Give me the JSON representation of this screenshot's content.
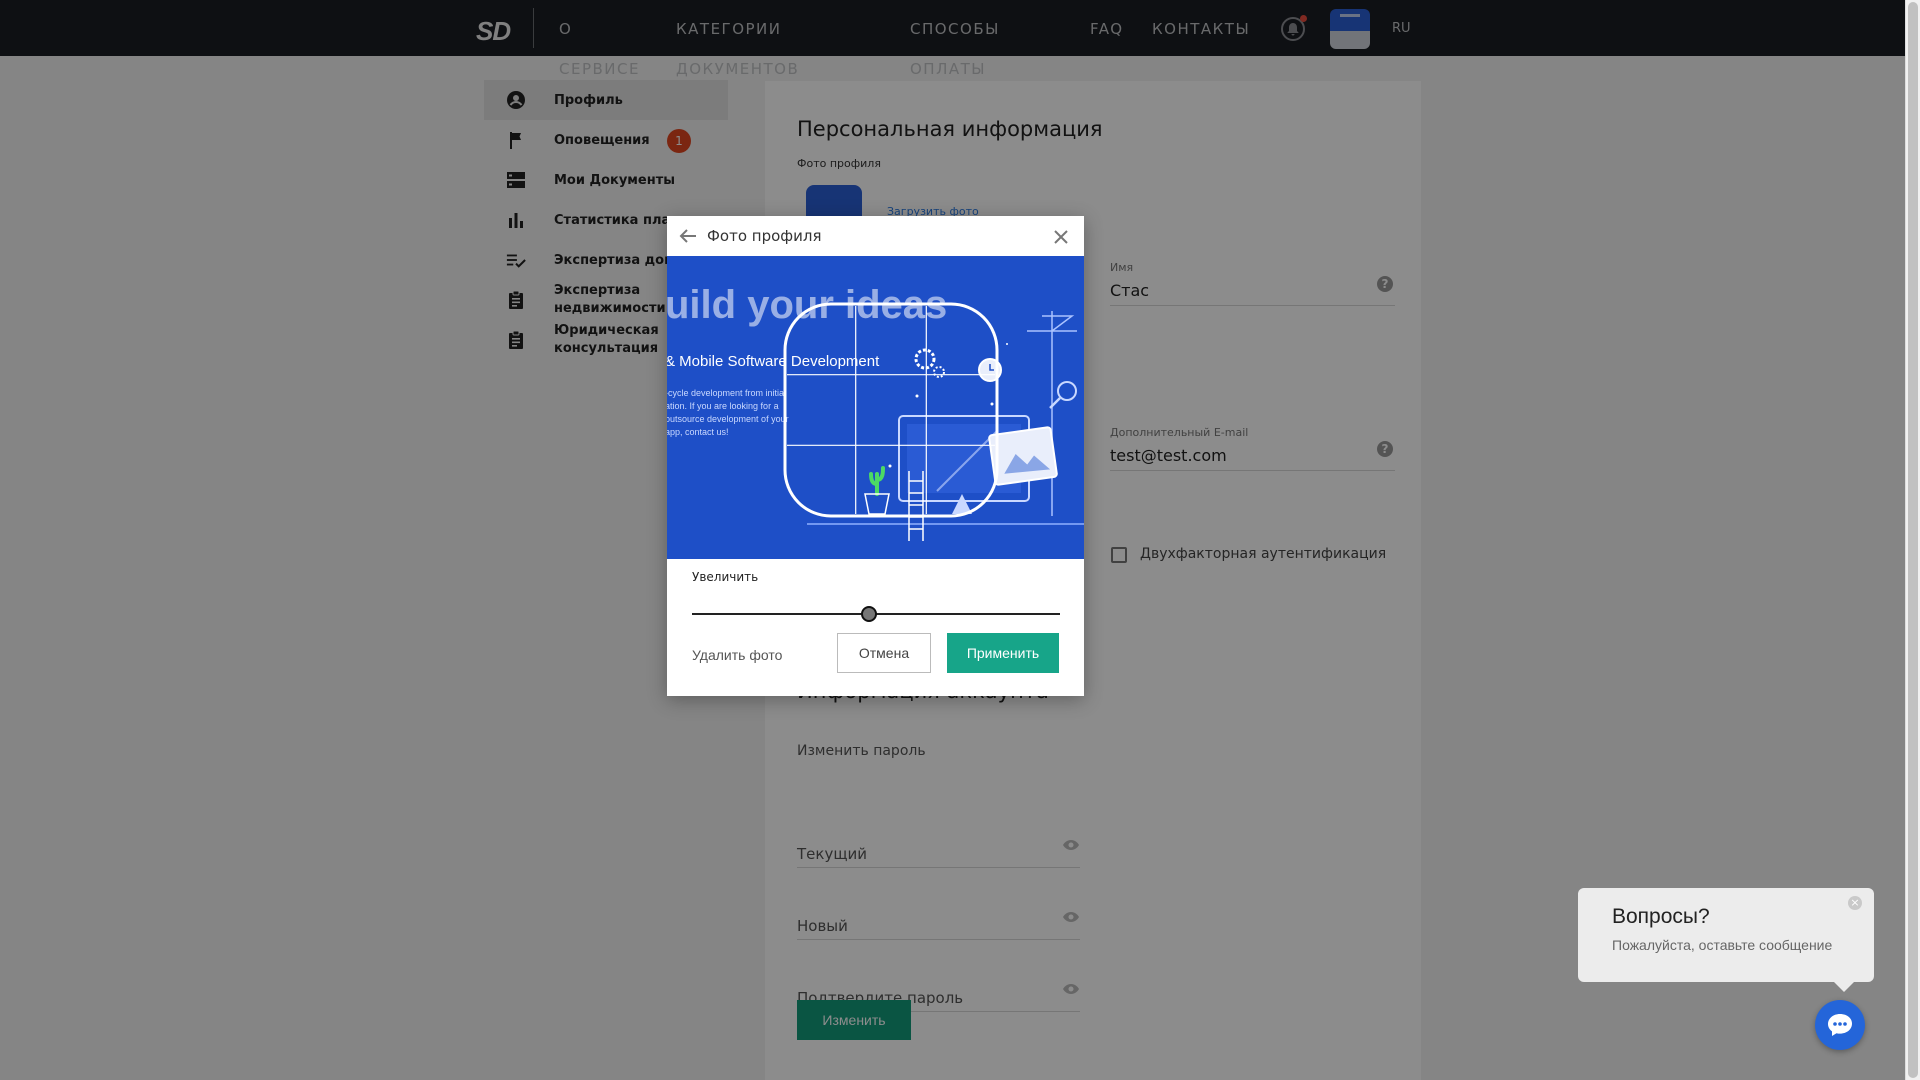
{
  "nav": {
    "logo": "SD",
    "items": [
      {
        "line1": "О",
        "line2": "СЕРВИСЕ"
      },
      {
        "line1": "КАТЕГОРИИ",
        "line2": "ДОКУМЕНТОВ"
      },
      {
        "line1": "СПОСОБЫ",
        "line2": "ОПЛАТЫ"
      },
      {
        "line1": "FAQ",
        "line2": ""
      },
      {
        "line1": "КОНТАКТЫ",
        "line2": ""
      }
    ],
    "language": "RU",
    "icons": [
      "bell-icon",
      "avatar"
    ]
  },
  "sidebar": {
    "items": [
      {
        "label": "Профиль",
        "icon": "person-circle-icon",
        "active": true
      },
      {
        "label": "Оповещения",
        "icon": "flag-icon",
        "badge": "1"
      },
      {
        "label": "Мои Документы",
        "icon": "storage-icon"
      },
      {
        "label": "Статистика плате",
        "icon": "bar-chart-icon"
      },
      {
        "label": "Экспертиза докум",
        "icon": "checklist-icon"
      },
      {
        "label": "Экспертиза недвижимости",
        "icon": "clipboard-icon"
      },
      {
        "label": "Юридическая консультация",
        "icon": "clipboard-icon"
      }
    ]
  },
  "profile": {
    "title": "Персональная информация",
    "photo_label": "Фото профиля",
    "upload_link": "Загрузить фото",
    "name_label": "Имя",
    "name_value": "Стас",
    "email_label": "Дополнительный E-mail",
    "email_value": "test@test.com",
    "two_factor_label": "Двухфакторная аутентификация",
    "two_factor_checked": false
  },
  "account": {
    "title": "Информация аккаунта",
    "change_password_link": "Изменить пароль",
    "current_placeholder": "Текущий",
    "new_placeholder": "Новый",
    "confirm_placeholder": "Подтвердите пароль",
    "change_button": "Изменить"
  },
  "modal": {
    "title": "Фото профиля",
    "image_texts": {
      "headline": "uild your ideas",
      "subline": "& Mobile Software Development",
      "body": [
        "-cycle development from initial",
        "ation. If you are looking for a",
        "outsource development of your",
        "app, contact us!"
      ]
    },
    "zoom_label": "Увеличить",
    "zoom_fraction": 0.48,
    "delete_button": "Удалить фото",
    "cancel_button": "Отмена",
    "apply_button": "Применить"
  },
  "chat": {
    "title": "Вопросы?",
    "subtitle": "Пожалуйста, оставьте сообщение"
  },
  "colors": {
    "topbar": "#1b1e24",
    "accent_green": "#17a589",
    "badge_red": "#e0461f",
    "chat_blue": "#2465d9",
    "image_blue": "#1e4fc7"
  }
}
